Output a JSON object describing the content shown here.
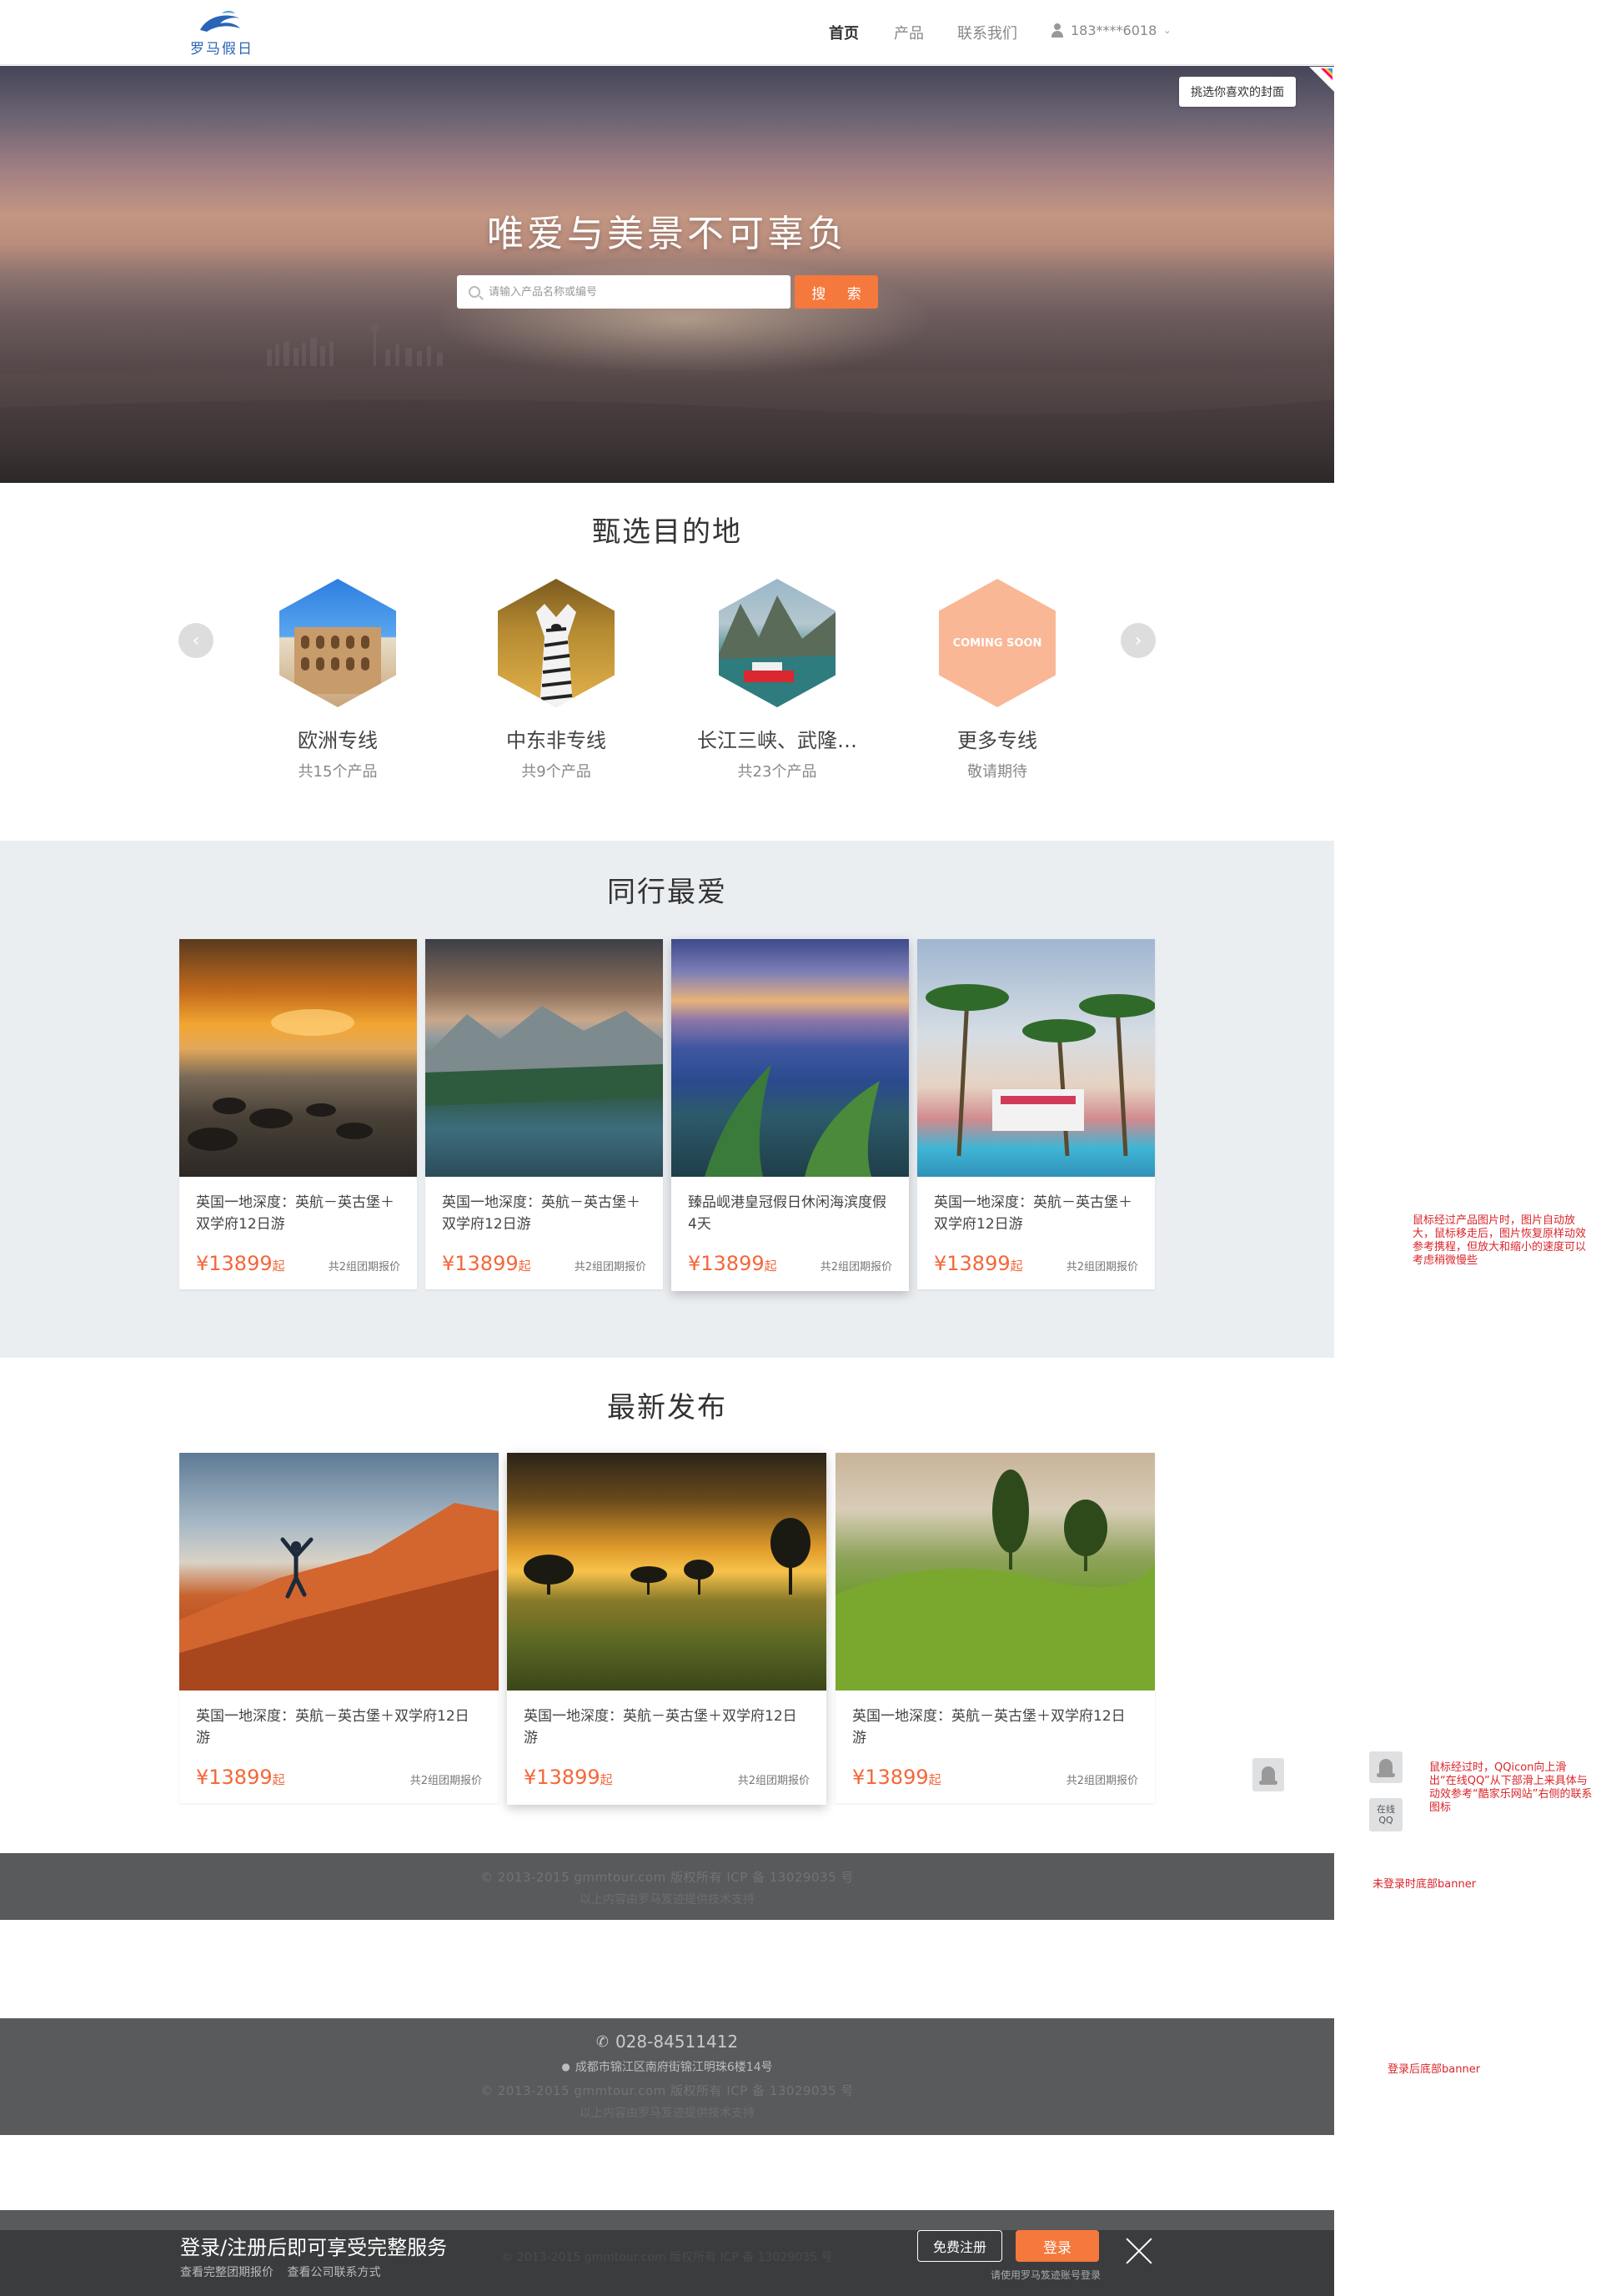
{
  "header": {
    "logo_text": "罗马假日",
    "nav": [
      "首页",
      "产品",
      "联系我们"
    ],
    "user": "183****6018"
  },
  "hero": {
    "title": "唯爱与美景不可辜负",
    "search_placeholder": "请输入产品名称或编号",
    "search_button": "搜 索",
    "cover_button": "挑选你喜欢的封面"
  },
  "destinations": {
    "title": "甄选目的地",
    "items": [
      {
        "name": "欧洲专线",
        "count": "共15个产品"
      },
      {
        "name": "中东非专线",
        "count": "共9个产品"
      },
      {
        "name": "长江三峡、武隆…",
        "count": "共23个产品"
      },
      {
        "name": "更多专线",
        "count": "敬请期待",
        "badge": "COMING SOON"
      }
    ]
  },
  "favorites": {
    "title": "同行最爱",
    "items": [
      {
        "title": "英国一地深度：英航－英古堡＋双学府12日游",
        "price": "¥13899",
        "unit": "起",
        "quote": "共2组团期报价"
      },
      {
        "title": "英国一地深度：英航－英古堡＋双学府12日游",
        "price": "¥13899",
        "unit": "起",
        "quote": "共2组团期报价"
      },
      {
        "title": "臻品岘港皇冠假日休闲海滨度假4天",
        "price": "¥13899",
        "unit": "起",
        "quote": "共2组团期报价"
      },
      {
        "title": "英国一地深度：英航－英古堡＋双学府12日游",
        "price": "¥13899",
        "unit": "起",
        "quote": "共2组团期报价"
      }
    ]
  },
  "latest": {
    "title": "最新发布",
    "items": [
      {
        "title": "英国一地深度：英航－英古堡＋双学府12日游",
        "price": "¥13899",
        "unit": "起",
        "quote": "共2组团期报价"
      },
      {
        "title": "英国一地深度：英航－英古堡＋双学府12日游",
        "price": "¥13899",
        "unit": "起",
        "quote": "共2组团期报价"
      },
      {
        "title": "英国一地深度：英航－英古堡＋双学府12日游",
        "price": "¥13899",
        "unit": "起",
        "quote": "共2组团期报价"
      }
    ]
  },
  "footer_logged_out": {
    "copyright": "© 2013-2015 gmmtour.com 版权所有 ICP 备 13029035 号",
    "tech": "以上内容由罗马笈迹提供技术支持"
  },
  "footer_logged_in": {
    "phone": "028-84511412",
    "address": "成都市锦江区南府街锦江明珠6楼14号",
    "copyright": "© 2013-2015 gmmtour.com 版权所有 ICP 备 13029035 号",
    "tech": "以上内容由罗马笈迹提供技术支持"
  },
  "login_bar": {
    "title": "登录/注册后即可享受完整服务",
    "sub1": "查看完整团期报价",
    "sub2": "查看公司联系方式",
    "register": "免费注册",
    "login": "登录",
    "hint": "请使用罗马笈迹账号登录",
    "behind_text": "© 2013-2015 gmmtour.com 版权所有 ICP 备 13029035 号"
  },
  "side": {
    "qq_label": "在线QQ"
  },
  "annotations": {
    "hover_product": "鼠标经过产品图片时，图片自动放大，鼠标移走后，图片恢复原样动效参考携程，但放大和缩小的速度可以考虑稍微慢些",
    "hover_qq": "鼠标经过时，QQicon向上滑出“在线QQ”从下部滑上来具体与动效参考“酷家乐网站”右侧的联系图标",
    "banner_logged_out": "未登录时底部banner",
    "banner_logged_in": "登录后底部banner"
  },
  "colors": {
    "accent": "#f5783d",
    "price": "#f5663a",
    "footer": "#595a5c",
    "band": "#ebeef1",
    "annotation": "#d9242a"
  }
}
